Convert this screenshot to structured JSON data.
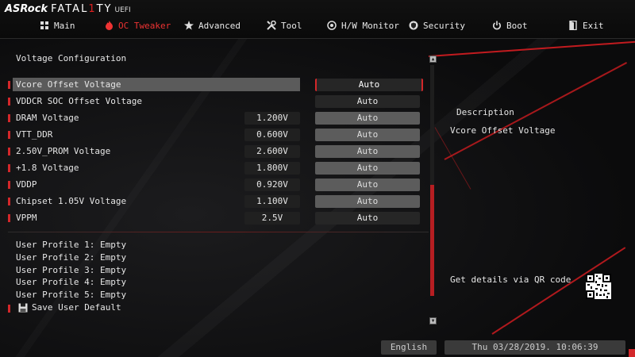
{
  "brand": {
    "name": "ASRock",
    "sub": "FATAL",
    "one": "1",
    "ty": "TY",
    "uefi": "UEFI"
  },
  "tabs": [
    {
      "label": "Main",
      "icon": "grid-icon"
    },
    {
      "label": "OC Tweaker",
      "icon": "flame-icon",
      "active": true
    },
    {
      "label": "Advanced",
      "icon": "star-icon"
    },
    {
      "label": "Tool",
      "icon": "tools-icon"
    },
    {
      "label": "H/W Monitor",
      "icon": "monitor-icon"
    },
    {
      "label": "Security",
      "icon": "shield-icon"
    },
    {
      "label": "Boot",
      "icon": "power-icon"
    },
    {
      "label": "Exit",
      "icon": "exit-icon"
    }
  ],
  "section_title": "Voltage Configuration",
  "rows": [
    {
      "label": "Vcore Offset Voltage",
      "value": "",
      "option": "Auto",
      "selected": true
    },
    {
      "label": "VDDCR SOC Offset Voltage",
      "value": "",
      "option": "Auto"
    },
    {
      "label": "DRAM Voltage",
      "value": "1.200V",
      "option": "Auto"
    },
    {
      "label": "VTT_DDR",
      "value": "0.600V",
      "option": "Auto"
    },
    {
      "label": "2.50V_PROM Voltage",
      "value": "2.600V",
      "option": "Auto"
    },
    {
      "label": "+1.8 Voltage",
      "value": "1.800V",
      "option": "Auto"
    },
    {
      "label": "VDDP",
      "value": "0.920V",
      "option": "Auto"
    },
    {
      "label": "Chipset 1.05V Voltage",
      "value": "1.100V",
      "option": "Auto"
    },
    {
      "label": "VPPM",
      "value": "2.5V",
      "option": "Auto"
    }
  ],
  "profiles": [
    "User Profile 1: Empty",
    "User Profile 2: Empty",
    "User Profile 3: Empty",
    "User Profile 4: Empty",
    "User Profile 5: Empty"
  ],
  "save_default": "Save User Default",
  "description": {
    "title": "Description",
    "text": "Vcore Offset Voltage"
  },
  "qr_text": "Get details via QR code",
  "footer": {
    "language": "English",
    "datetime": "Thu 03/28/2019. 10:06:39"
  },
  "colors": {
    "accent": "#d3272a",
    "background": "#0b0b0c",
    "selected_row": "#5b5b5b"
  }
}
